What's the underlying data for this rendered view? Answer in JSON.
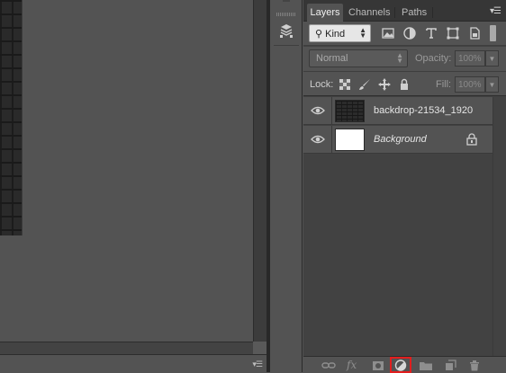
{
  "panel": {
    "tabs": [
      {
        "label": "Layers",
        "active": true
      },
      {
        "label": "Channels",
        "active": false
      },
      {
        "label": "Paths",
        "active": false
      }
    ],
    "menu_icon": "panel-menu-icon"
  },
  "filter": {
    "kind_label": "Kind",
    "icons": [
      "pixel-filter-icon",
      "adjustment-filter-icon",
      "type-filter-icon",
      "shape-filter-icon",
      "smart-object-filter-icon"
    ]
  },
  "blend": {
    "mode": "Normal",
    "opacity_label": "Opacity:",
    "opacity_value": "100%"
  },
  "lock": {
    "label": "Lock:",
    "fill_label": "Fill:",
    "fill_value": "100%"
  },
  "layers": [
    {
      "name": "backdrop-21534_1920",
      "visible": true,
      "italic": false,
      "locked": false
    },
    {
      "name": "Background",
      "visible": true,
      "italic": true,
      "locked": true
    }
  ],
  "bottom_bar": {
    "icons": [
      "link-layers-icon",
      "fx-icon",
      "layer-mask-icon",
      "adjustment-layer-icon",
      "group-folder-icon",
      "new-layer-icon",
      "trash-icon"
    ],
    "fx_text": "fx",
    "highlighted": "adjustment-layer-icon",
    "highlight_color": "#e21e1e"
  }
}
